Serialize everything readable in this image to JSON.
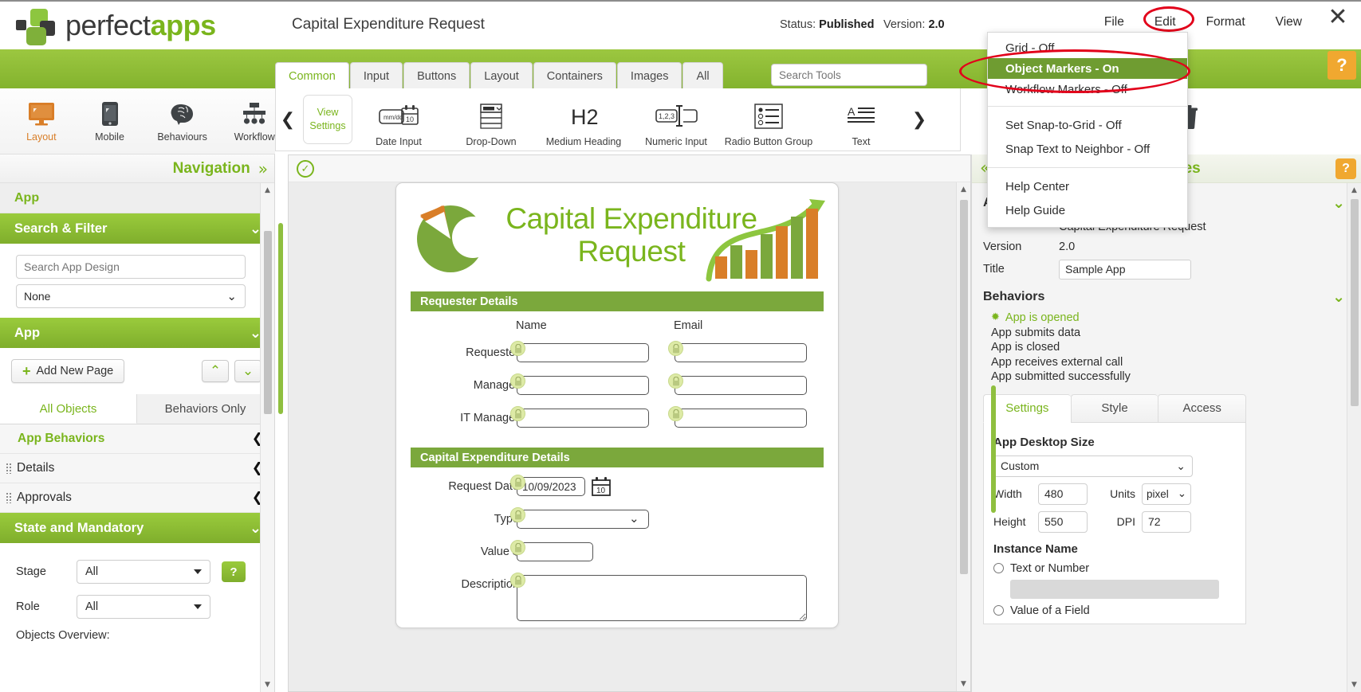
{
  "topbar": {
    "logo_text_1": "perfect",
    "logo_text_2": "apps",
    "doc_title": "Capital Expenditure Request",
    "status_label": "Status:",
    "status_value": "Published",
    "version_label": "Version:",
    "version_value": "2.0",
    "menus": [
      "File",
      "Edit",
      "Format",
      "View"
    ],
    "close_glyph": "✕"
  },
  "view_menu": {
    "items": [
      {
        "label": "Grid - Off",
        "selected": false
      },
      {
        "label": "Object Markers - On",
        "selected": true
      },
      {
        "label": "Workflow Markers - Off",
        "selected": false
      },
      {
        "label": "Set Snap-to-Grid - Off",
        "selected": false
      },
      {
        "label": "Snap Text to Neighbor - Off",
        "selected": false
      },
      {
        "label": "Help Center",
        "selected": false
      },
      {
        "label": "Help Guide",
        "selected": false
      }
    ]
  },
  "left_tools": [
    {
      "label": "Layout",
      "icon": "monitor-icon",
      "selected": true
    },
    {
      "label": "Mobile",
      "icon": "phone-icon",
      "selected": false
    },
    {
      "label": "Behaviours",
      "icon": "brain-icon",
      "selected": false
    },
    {
      "label": "Workflow",
      "icon": "workflow-icon",
      "selected": false
    }
  ],
  "ribbon": {
    "tabs": [
      "Common",
      "Input",
      "Buttons",
      "Layout",
      "Containers",
      "Images",
      "All"
    ],
    "active_tab": "Common",
    "search_placeholder": "Search Tools",
    "view_settings": "View Settings",
    "tools": [
      {
        "label": "Date Input",
        "icon": "date-input-icon"
      },
      {
        "label": "Drop-Down",
        "icon": "dropdown-icon"
      },
      {
        "label": "Medium Heading",
        "icon": "h2-icon"
      },
      {
        "label": "Numeric Input",
        "icon": "numeric-input-icon"
      },
      {
        "label": "Radio Button Group",
        "icon": "radio-group-icon"
      },
      {
        "label": "Text",
        "icon": "text-icon"
      }
    ],
    "prev_glyph": "❮",
    "next_glyph": "❯"
  },
  "sidebar": {
    "nav_title": "Navigation",
    "collapse_glyph": "»",
    "app_section": "App",
    "search_filter": {
      "header": "Search & Filter",
      "search_placeholder": "Search App Design",
      "filter_value": "None"
    },
    "app_group": {
      "header": "App",
      "add_page_label": "Add New Page",
      "collapse_all_glyph": "⌃",
      "expand_all_glyph": "⌄"
    },
    "tabs": [
      "All Objects",
      "Behaviors Only"
    ],
    "active_tab": "All Objects",
    "tree": [
      {
        "label": "App Behaviors",
        "indent": true,
        "chev": "❮"
      },
      {
        "label": "Details",
        "indent": false,
        "chev": "❮"
      },
      {
        "label": "Approvals",
        "indent": false,
        "chev": "❮"
      }
    ],
    "state_mandatory": {
      "header": "State and Mandatory",
      "stage_label": "Stage",
      "stage_value": "All",
      "help_label": "?",
      "role_label": "Role",
      "role_value": "All"
    },
    "objects_overview": "Objects Overview:"
  },
  "canvas": {
    "form_title_line1": "Capital Expenditure",
    "form_title_line2": "Request",
    "sections": [
      {
        "header": "Requester Details",
        "column_headers": [
          "Name",
          "Email"
        ],
        "rows": [
          {
            "label": "Requester",
            "name_value": "",
            "email_value": ""
          },
          {
            "label": "Manager",
            "name_value": "",
            "email_value": ""
          },
          {
            "label": "IT Manager",
            "name_value": "",
            "email_value": ""
          }
        ]
      },
      {
        "header": "Capital Expenditure Details",
        "fields": [
          {
            "label": "Request Date",
            "value": "10/09/2023",
            "type": "date"
          },
          {
            "label": "Type",
            "value": "",
            "type": "dropdown"
          },
          {
            "label": "Value $",
            "value": "",
            "type": "text"
          },
          {
            "label": "Description",
            "value": "",
            "type": "textarea"
          }
        ]
      }
    ]
  },
  "properties": {
    "title": "Properties",
    "collapse_glyph": "«",
    "help_label": "?",
    "app_section": "App",
    "app_name_value": "Capital Expenditure Request",
    "rows": [
      {
        "key": "Version",
        "value": "2.0",
        "editable": false
      },
      {
        "key": "Title",
        "value": "Sample App",
        "editable": true
      }
    ],
    "behaviors_header": "Behaviors",
    "behaviors": [
      {
        "label": "App is opened",
        "active": true
      },
      {
        "label": "App submits data",
        "active": false
      },
      {
        "label": "App is closed",
        "active": false
      },
      {
        "label": "App receives external call",
        "active": false
      },
      {
        "label": "App submitted successfully",
        "active": false
      }
    ],
    "tabs": [
      "Settings",
      "Style",
      "Access"
    ],
    "active_tab": "Settings",
    "settings": {
      "group_title": "App Desktop Size",
      "size_preset": "Custom",
      "width_label": "Width",
      "width_value": "480",
      "units_label": "Units",
      "units_value": "pixel",
      "height_label": "Height",
      "height_value": "550",
      "dpi_label": "DPI",
      "dpi_value": "72",
      "instance_name_title": "Instance Name",
      "instance_options": [
        "Text or Number",
        "Value of a Field"
      ]
    }
  },
  "colors": {
    "brand_green": "#7ab51d",
    "band_green": "#8dc63f",
    "menu_select_green": "#6f9c31",
    "orange": "#d97e28",
    "annotation_red": "#e2001a",
    "help_orange": "#f0a830"
  }
}
